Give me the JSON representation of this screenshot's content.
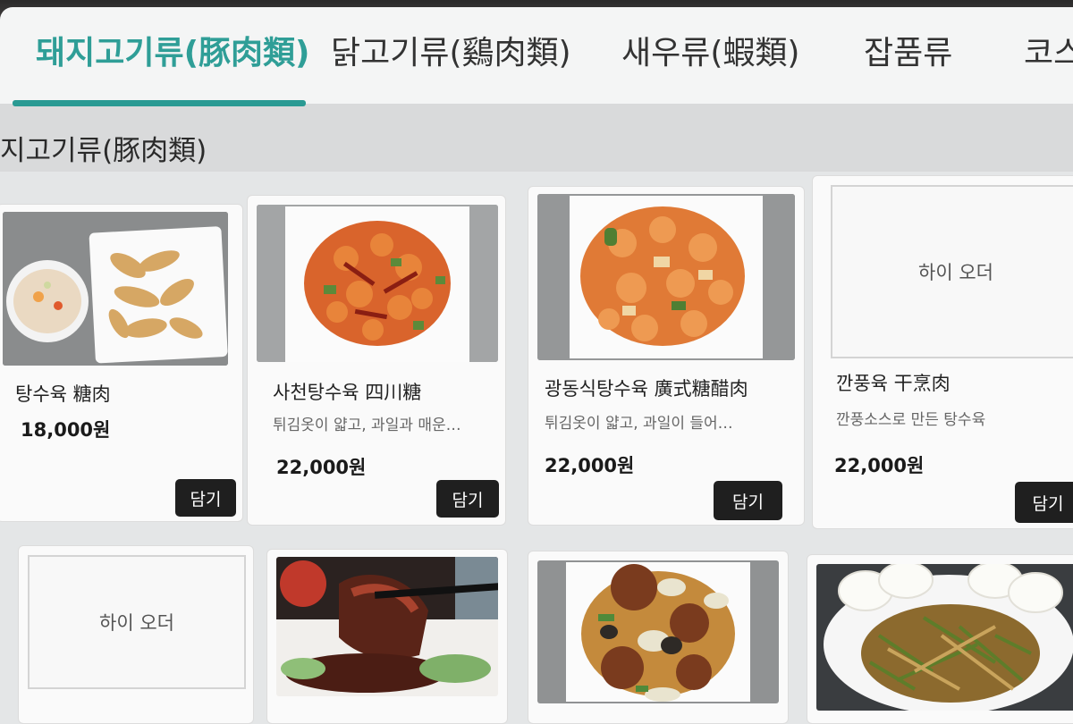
{
  "tabs": [
    {
      "label": "돼지고기류(豚肉類)",
      "active": true
    },
    {
      "label": "닭고기류(鷄肉類)",
      "active": false
    },
    {
      "label": "새우류(蝦類)",
      "active": false
    },
    {
      "label": "잡품류",
      "active": false
    },
    {
      "label": "코스",
      "active": false
    }
  ],
  "section": {
    "title": "지고기류(豚肉類)"
  },
  "cart_label": "담기",
  "placeholder_text": "하이 오더",
  "items": [
    {
      "name": "탕수육 糖肉",
      "desc": "",
      "price": "18,000원"
    },
    {
      "name": "사천탕수육 四川糖",
      "desc": "튀김옷이 얇고, 과일과 매운…",
      "price": "22,000원"
    },
    {
      "name": "광동식탕수육 廣式糖醋肉",
      "desc": "튀김옷이 얇고, 과일이 들어…",
      "price": "22,000원"
    },
    {
      "name": "깐풍육 干烹肉",
      "desc": "깐풍소스로 만든 탕수육",
      "price": "22,000원"
    },
    {
      "name": "",
      "desc": "",
      "price": ""
    },
    {
      "name": "",
      "desc": "",
      "price": ""
    },
    {
      "name": "",
      "desc": "",
      "price": ""
    },
    {
      "name": "",
      "desc": "",
      "price": ""
    }
  ],
  "colors": {
    "accent": "#2a9a93",
    "button": "#1f1f1f",
    "background": "#e4e6e7"
  }
}
